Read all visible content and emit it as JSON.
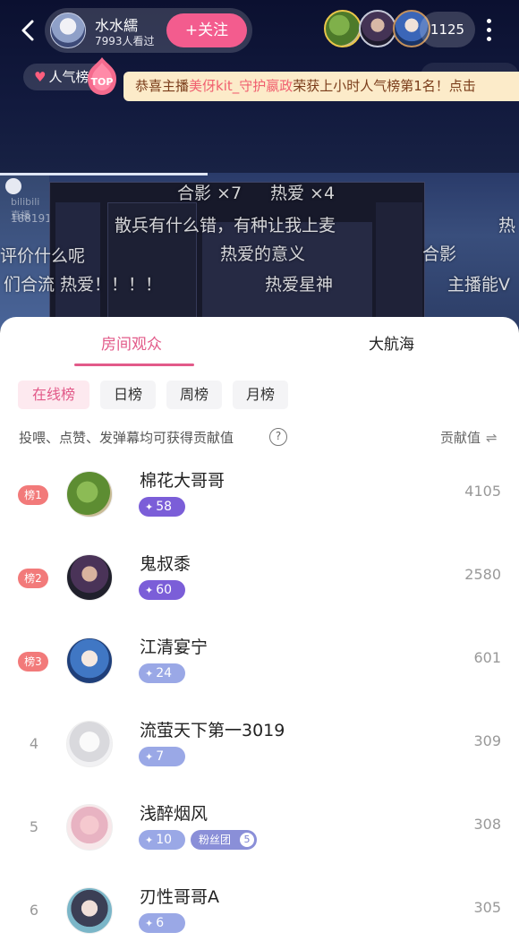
{
  "header": {
    "host_name": "水水繻",
    "viewers": "7993人看过",
    "follow_label": "+关注",
    "viewer_count": "1125"
  },
  "stream": {
    "popularity_tag": "人气榜",
    "top_badge_text": "TOP",
    "announcement_prefix": "恭喜主播",
    "announcement_highlight": "美伢kit_守护嬴政",
    "announcement_suffix": "荣获上小时人气榜第1名！点击",
    "watermark": "bilibili直播",
    "uid": "1881915847"
  },
  "danmaku": [
    "合影 ×7",
    "热爱 ×4",
    "散兵有什么错，有种让我上麦",
    "热爱的意义",
    "合影",
    "热爱星神",
    "主播能V",
    "评价什么呢",
    "们合流 热爱！！！！",
    "热"
  ],
  "tabs": [
    "房间观众",
    "大航海"
  ],
  "chips": [
    "在线榜",
    "日榜",
    "周榜",
    "月榜"
  ],
  "hint": "投喂、点赞、发弹幕均可获得贡献值",
  "contrib_label": "贡献值",
  "rows": [
    {
      "rank": "榜1",
      "name": "棉花大哥哥",
      "level": "58",
      "score": "4105"
    },
    {
      "rank": "榜2",
      "name": "鬼叔黍",
      "level": "60",
      "score": "2580"
    },
    {
      "rank": "榜3",
      "name": "江清宴宁",
      "level": "24",
      "score": "601"
    },
    {
      "rank": "4",
      "name": "流萤天下第一3019",
      "level": "7",
      "score": "309"
    },
    {
      "rank": "5",
      "name": "浅醉烟风",
      "level": "10",
      "fan_label": "粉丝团",
      "fan_level": "5",
      "score": "308"
    },
    {
      "rank": "6",
      "name": "刃性哥哥A",
      "level": "6",
      "score": "305"
    }
  ],
  "colors": {
    "accent": "#e25a89",
    "follow": "#f35c8e",
    "rank_badge": "#f27a7a"
  }
}
